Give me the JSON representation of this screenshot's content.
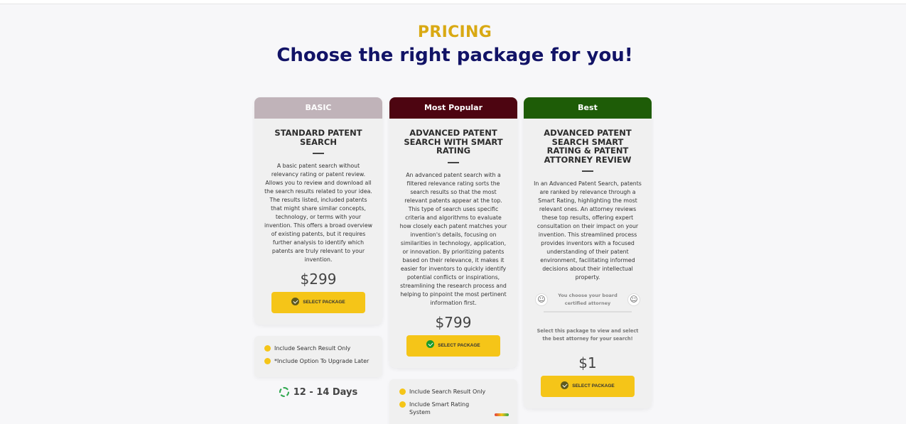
{
  "header": {
    "eyebrow": "PRICING",
    "headline": "Choose the right package for you!"
  },
  "colors": {
    "eyebrow": "#d9a913",
    "headline": "#121366",
    "basic_head": "#c0b3b9",
    "popular_head": "#4d0511",
    "best_head": "#1e5c07",
    "button": "#f5c518",
    "check_dark": "#5f5a1e",
    "check_green": "#1c9a2c"
  },
  "plans": [
    {
      "badge": "BASIC",
      "title": "STANDARD PATENT SEARCH",
      "description": "A basic patent search without relevancy rating or patent review. Allows you to review and download all the search results related to your idea. The results listed, included patents that might share similar concepts, technology, or terms with your invention. This offers a broad overview of existing patents, but it requires further analysis to identify which patents are truly relevant to your invention.",
      "price": "$299",
      "button": "SELECT PACKAGE",
      "features": [
        "Include Search Result Only",
        "*Include Option To Upgrade Later"
      ],
      "delivery": "12 - 14 Days"
    },
    {
      "badge": "Most Popular",
      "title": "ADVANCED PATENT SEARCH WITH SMART RATING",
      "description": "An advanced patent search with a filtered relevance rating sorts the search results so that the most relevant patents appear at the top. This type of search uses specific criteria and algorithms to evaluate how closely each patent matches your invention's details, focusing on similarities in technology, application, or innovation. By prioritizing patents based on their relevance, it makes it easier for inventors to quickly identify potential conflicts or inspirations, streamlining the research process and helping to pinpoint the most pertinent information first.",
      "price": "$799",
      "button": "SELECT PACKAGE",
      "features": [
        "Include Search Result Only",
        "Include Smart Rating System"
      ]
    },
    {
      "badge": "Best",
      "title": "ADVANCED PATENT SEARCH SMART RATING & PATENT ATTORNEY REVIEW",
      "description": "In an Advanced Patent Search, patents are ranked by relevance through a Smart Rating, highlighting the most relevant ones. An attorney reviews these top results, offering expert consultation on their impact on your invention. This streamlined process provides inventors with a focused understanding of their patent environment, facilitating informed decisions about their intellectual property.",
      "attorney_note": "You choose your board certified attorney",
      "select_note": "Select this package to view and select the best attorney for your search!",
      "price": "$1",
      "button": "SELECT PACKAGE"
    }
  ]
}
